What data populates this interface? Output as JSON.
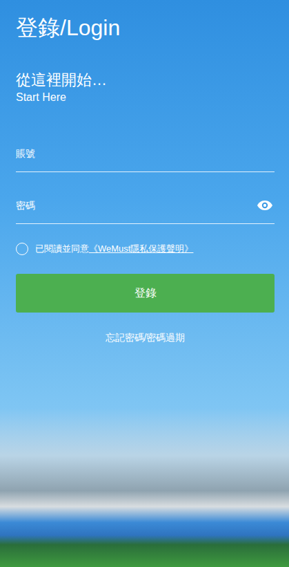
{
  "header": {
    "title": "登錄/Login",
    "subtitle": "從這裡開始…",
    "subtitle_en": "Start Here"
  },
  "fields": [
    {
      "placeholder": "賬號",
      "kind": "text"
    },
    {
      "placeholder": "密碼",
      "kind": "password"
    }
  ],
  "agreement": {
    "text": "已閱讀並同意",
    "link": "《WeMust隱私保護聲明》",
    "checked": false
  },
  "login_button": "登錄",
  "forgot_link": "忘記密碼/密碼過期"
}
